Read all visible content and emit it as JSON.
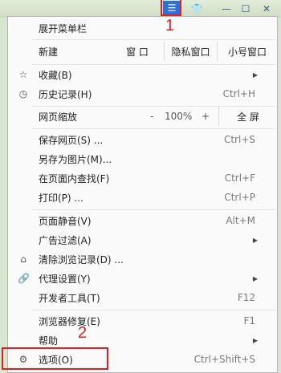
{
  "titlebar": {
    "menu_icon": "hamburger-icon",
    "skin_icon": "shirt-icon",
    "min_icon": "minimize-icon",
    "max_icon": "maximize-icon",
    "close_icon": "close-icon"
  },
  "annotations": {
    "n1": "1",
    "n2": "2"
  },
  "colors": {
    "accent": "#2f6fd6",
    "annotation": "#e02020"
  },
  "menu": {
    "expand_menubar": "展开菜单栏",
    "new": {
      "label": "新建",
      "window": "窗 口",
      "private": "隐私窗口",
      "small": "小号窗口"
    },
    "favorites": {
      "label": "收藏(B)",
      "icon": "star-icon"
    },
    "history": {
      "label": "历史记录(H)",
      "shortcut": "Ctrl+H",
      "icon": "clock-icon"
    },
    "zoom": {
      "label": "网页缩放",
      "minus": "-",
      "value": "100%",
      "plus": "+",
      "fullscreen": "全 屏"
    },
    "save_page": {
      "label": "保存网页(S) ...",
      "shortcut": "Ctrl+S"
    },
    "save_image": {
      "label": "另存为图片(M)..."
    },
    "find": {
      "label": "在页面内查找(F)",
      "shortcut": "Ctrl+F"
    },
    "print": {
      "label": "打印(P) ...",
      "shortcut": "Ctrl+P"
    },
    "mute": {
      "label": "页面静音(V)",
      "shortcut": "Alt+M"
    },
    "adblock": {
      "label": "广告过滤(A)"
    },
    "clear": {
      "label": "清除浏览记录(D) ...",
      "icon": "broom-icon"
    },
    "proxy": {
      "label": "代理设置(Y)",
      "icon": "link-icon"
    },
    "devtools": {
      "label": "开发者工具(T)",
      "shortcut": "F12"
    },
    "repair": {
      "label": "浏览器修复(E)",
      "shortcut": "F1"
    },
    "help": {
      "label": "帮助"
    },
    "options": {
      "label": "选项(O)",
      "shortcut": "Ctrl+Shift+S",
      "icon": "gear-icon"
    }
  }
}
